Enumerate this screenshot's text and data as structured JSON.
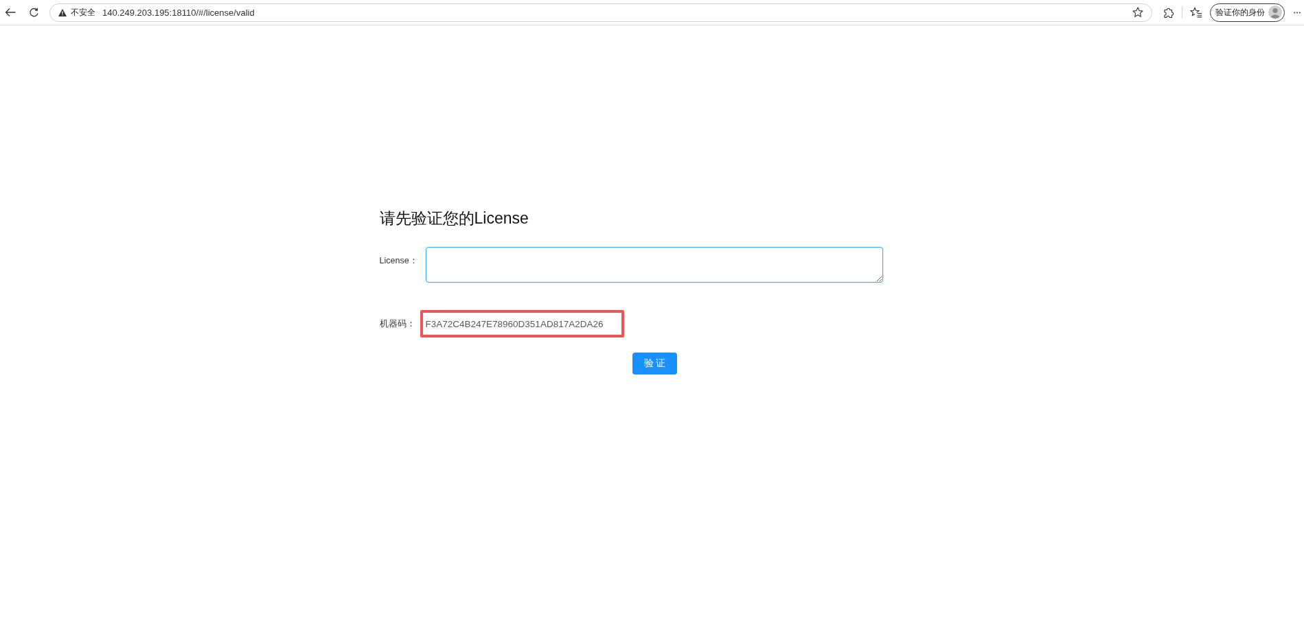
{
  "browser": {
    "security_label": "不安全",
    "url": "140.249.203.195:18110/#/license/valid",
    "profile_label": "验证你的身份"
  },
  "form": {
    "title": "请先验证您的License",
    "fields": [
      {
        "kind": "textarea",
        "label": "License：",
        "focused": true
      },
      {
        "kind": "code",
        "label": "机器码：",
        "value": "F3A72C4B247E78960D351AD817A2DA26",
        "highlighted": true
      }
    ],
    "submit_button": "验 证"
  }
}
